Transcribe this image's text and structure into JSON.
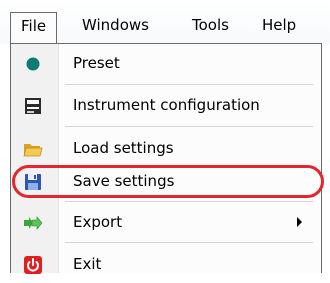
{
  "menubar": {
    "items": [
      {
        "label": "File"
      },
      {
        "label": "Windows"
      },
      {
        "label": "Tools"
      },
      {
        "label": "Help"
      }
    ]
  },
  "file_menu": {
    "items": [
      {
        "label": "Preset",
        "icon": "preset-dot-icon"
      },
      {
        "label": "Instrument configuration",
        "icon": "instrument-config-icon"
      },
      {
        "label": "Load settings",
        "icon": "folder-open-icon"
      },
      {
        "label": "Save settings",
        "icon": "floppy-disk-icon",
        "highlighted": true
      },
      {
        "label": "Export",
        "icon": "export-arrows-icon",
        "has_submenu": true
      },
      {
        "label": "Exit",
        "icon": "power-icon"
      }
    ]
  },
  "colors": {
    "highlight_outline": "#e3262e",
    "preset_dot": "#0d7a73",
    "export_arrows": "#3aa53a",
    "exit_icon_bg": "#e02020"
  }
}
